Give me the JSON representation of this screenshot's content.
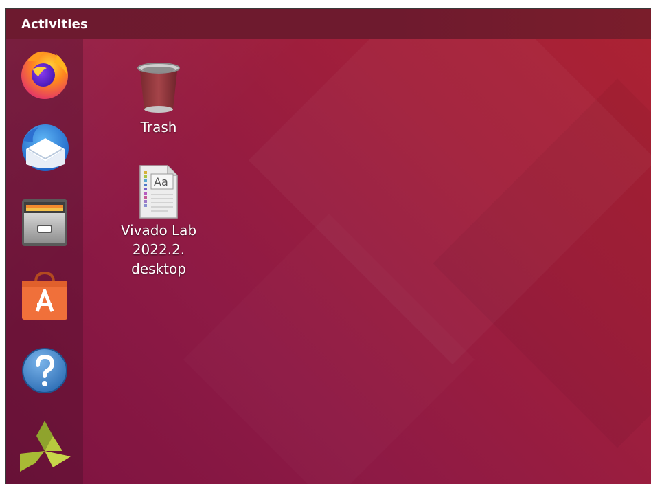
{
  "topbar": {
    "activities_label": "Activities"
  },
  "dock": {
    "items": [
      {
        "name": "Firefox",
        "icon": "firefox-icon"
      },
      {
        "name": "Thunderbird",
        "icon": "thunderbird-icon"
      },
      {
        "name": "Files",
        "icon": "files-icon"
      },
      {
        "name": "Ubuntu Software",
        "icon": "software-center-icon"
      },
      {
        "name": "Help",
        "icon": "help-icon"
      },
      {
        "name": "Vivado",
        "icon": "vivado-icon"
      }
    ]
  },
  "desktop": {
    "icons": [
      {
        "label_lines": [
          "Trash"
        ],
        "icon": "trash-icon"
      },
      {
        "label_lines": [
          "Vivado Lab",
          "2022.2.",
          "desktop"
        ],
        "icon": "text-document-icon"
      }
    ]
  },
  "colors": {
    "topbar": "#6e1a2e",
    "wallpaper_dark": "#7d1340",
    "wallpaper_light": "#ac2232",
    "firefox_orange": "#ff7a1a",
    "help_blue": "#3d82c8",
    "software_orange": "#f0703a",
    "vivado_green": "#b5c63a"
  }
}
